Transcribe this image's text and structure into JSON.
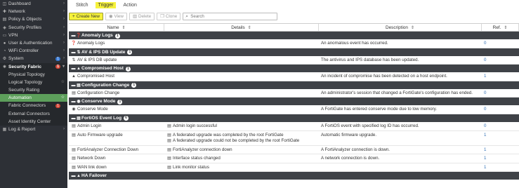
{
  "sidebar": {
    "items": [
      {
        "label": "Dashboard",
        "icon": "dashboard-icon",
        "glyph": "◫"
      },
      {
        "label": "Network",
        "icon": "network-icon",
        "glyph": "✚"
      },
      {
        "label": "Policy & Objects",
        "icon": "policy-icon",
        "glyph": "▤"
      },
      {
        "label": "Security Profiles",
        "icon": "security-profiles-icon",
        "glyph": "◈"
      },
      {
        "label": "VPN",
        "icon": "vpn-icon",
        "glyph": "▭"
      },
      {
        "label": "User & Authentication",
        "icon": "user-icon",
        "glyph": "●"
      },
      {
        "label": "WiFi Controller",
        "icon": "wifi-icon",
        "glyph": "◔"
      },
      {
        "label": "System",
        "icon": "system-icon",
        "glyph": "⚙",
        "badge": "1",
        "badge_color": "blue"
      },
      {
        "label": "Security Fabric",
        "icon": "security-fabric-icon",
        "glyph": "✳",
        "badge": "1",
        "badge_color": "red"
      }
    ],
    "sub_items": [
      {
        "label": "Physical Topology"
      },
      {
        "label": "Logical Topology",
        "star": "☆"
      },
      {
        "label": "Security Rating"
      },
      {
        "label": "Automation",
        "star": "☆"
      },
      {
        "label": "Fabric Connectors",
        "badge": "1"
      },
      {
        "label": "External Connectors"
      },
      {
        "label": "Asset Identity Center"
      }
    ],
    "last_item": {
      "label": "Log & Report",
      "icon": "log-report-icon",
      "glyph": "▦"
    }
  },
  "tabs": [
    "Stitch",
    "Trigger",
    "Action"
  ],
  "toolbar": {
    "create_label": "Create New",
    "view_label": "View",
    "delete_label": "Delete",
    "clone_label": "Clone",
    "search_placeholder": "Search"
  },
  "table": {
    "headers": {
      "name": "Name",
      "details": "Details",
      "description": "Description",
      "ref": "Ref."
    },
    "groups": [
      {
        "title": "Anomaly Logs",
        "count": "1",
        "icon": "❓",
        "rows": [
          {
            "name": "Anomaly Logs",
            "icon": "❓",
            "details": [],
            "description": "An anomalous event has occurred.",
            "ref": "0"
          }
        ]
      },
      {
        "title": "AV & IPS DB Update",
        "count": "1",
        "icon": "⇅",
        "rows": [
          {
            "name": "AV & IPS DB update",
            "icon": "⇅",
            "details": [],
            "description": "The antivirus and IPS database has been updated.",
            "ref": "0"
          }
        ]
      },
      {
        "title": "Compromised Host",
        "count": "1",
        "icon": "▲",
        "rows": [
          {
            "name": "Compromised Host",
            "icon": "▲",
            "details": [],
            "description": "An incident of compromise has been detected on a host endpoint.",
            "ref": "1"
          }
        ]
      },
      {
        "title": "Configuration Change",
        "count": "1",
        "icon": "▤",
        "rows": [
          {
            "name": "Configuration Change",
            "icon": "▤",
            "details": [],
            "description": "An administrator's session that changed a FortiGate's configuration has ended.",
            "ref": "0"
          }
        ]
      },
      {
        "title": "Conserve Mode",
        "count": "1",
        "icon": "◉",
        "rows": [
          {
            "name": "Conserve Mode",
            "icon": "◉",
            "details": [],
            "description": "A FortiGate has entered conserve mode due to low memory.",
            "ref": "0"
          }
        ]
      },
      {
        "title": "FortiOS Event Log",
        "count": "6",
        "icon": "▤",
        "rows": [
          {
            "name": "Admin Login",
            "icon": "▤",
            "details": [
              "Admin login successful"
            ],
            "description": "A FortiOS event with specified log ID has occurred.",
            "ref": "0"
          },
          {
            "name": "Auto Firmware upgrade",
            "icon": "▤",
            "details": [
              "A federated upgrade was completed by the root FortiGate",
              "A federated upgrade could not be completed by the root FortiGate"
            ],
            "description": "Automatic firmware upgrade.",
            "ref": "1"
          },
          {
            "name": "FortiAnalyzer Connection Down",
            "icon": "▤",
            "details": [
              "FortiAnalyzer connection down"
            ],
            "description": "A FortiAnalyzer connection is down.",
            "ref": "1"
          },
          {
            "name": "Network Down",
            "icon": "▤",
            "details": [
              "Interface status changed"
            ],
            "description": "A network connection is down.",
            "ref": "1"
          },
          {
            "name": "WAN link down",
            "icon": "▤",
            "details": [
              "Link monitor status"
            ],
            "description": "",
            "ref": "1"
          }
        ]
      },
      {
        "title": "HA Failover",
        "count": "",
        "icon": "▲",
        "rows": []
      }
    ]
  },
  "colors": {
    "sidebar_bg": "#2d3036",
    "active_nav": "#5d9f5b",
    "group_header_bg": "#3f4247",
    "highlight_yellow": "#f6f23a",
    "link_blue": "#2f6fb5"
  }
}
